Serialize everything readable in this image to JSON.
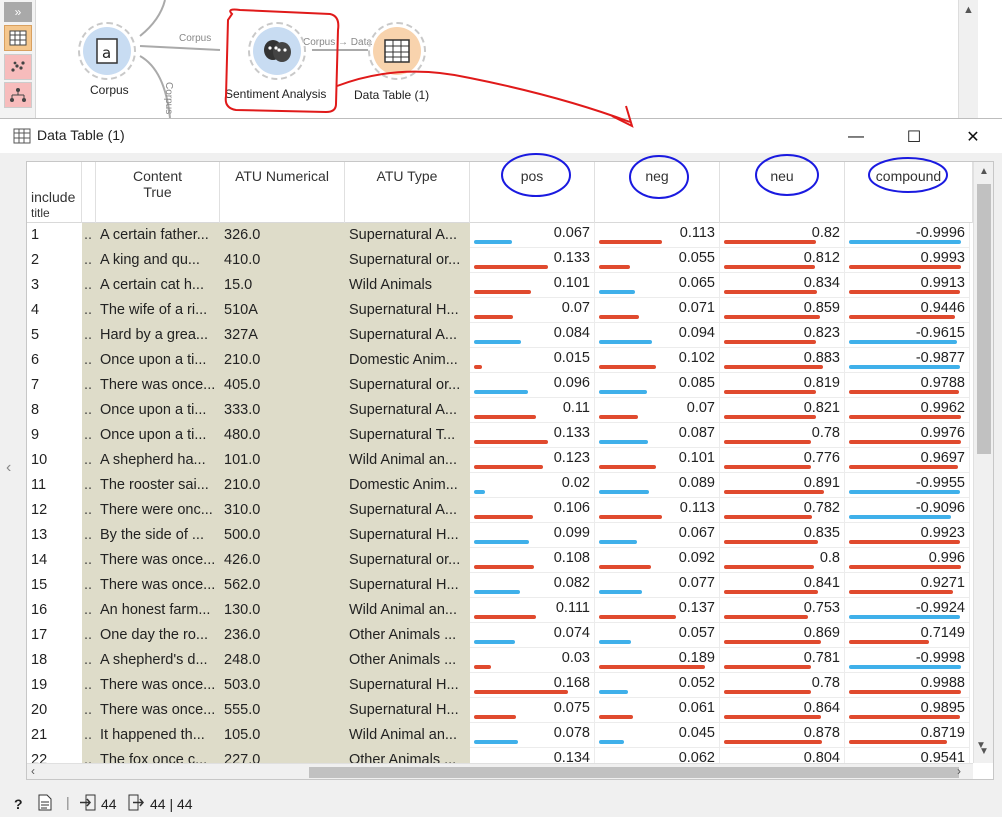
{
  "canvas": {
    "toolbox_expand": "»",
    "nodes": {
      "corpus": {
        "label": "Corpus",
        "glyph": "a"
      },
      "sentiment": {
        "label": "Sentiment Analysis"
      },
      "datatable": {
        "label": "Data Table (1)"
      }
    },
    "links": {
      "corpus_to_sentiment": "Corpus",
      "corpus_down": "Corpus",
      "sentiment_to_table": "Corpus → Data"
    }
  },
  "window": {
    "title": "Data Table (1)",
    "min_glyph": "—",
    "max_glyph": "☐",
    "close_glyph": "✕",
    "collapse_glyph": "‹"
  },
  "table": {
    "headers": {
      "include": "include",
      "include_sub": "title",
      "content": "Content",
      "content_sub": "True",
      "atu_num": "ATU Numerical",
      "atu_type": "ATU Type",
      "pos": "pos",
      "neg": "neg",
      "neu": "neu",
      "compound": "compound"
    },
    "rows": [
      {
        "i": "1",
        "c": "A certain father...",
        "n": "326.0",
        "t": "Supernatural A...",
        "pos": "0.067",
        "neg": "0.113",
        "neu": "0.82",
        "cmp": "-0.9996"
      },
      {
        "i": "2",
        "c": "A king and qu...",
        "n": "410.0",
        "t": "Supernatural or...",
        "pos": "0.133",
        "neg": "0.055",
        "neu": "0.812",
        "cmp": "0.9993"
      },
      {
        "i": "3",
        "c": "A certain cat h...",
        "n": "15.0",
        "t": "Wild Animals",
        "pos": "0.101",
        "neg": "0.065",
        "neu": "0.834",
        "cmp": "0.9913"
      },
      {
        "i": "4",
        "c": "The wife of a ri...",
        "n": "510A",
        "t": "Supernatural H...",
        "pos": "0.07",
        "neg": "0.071",
        "neu": "0.859",
        "cmp": "0.9446"
      },
      {
        "i": "5",
        "c": "Hard by a grea...",
        "n": "327A",
        "t": "Supernatural A...",
        "pos": "0.084",
        "neg": "0.094",
        "neu": "0.823",
        "cmp": "-0.9615"
      },
      {
        "i": "6",
        "c": "Once upon a ti...",
        "n": "210.0",
        "t": "Domestic Anim...",
        "pos": "0.015",
        "neg": "0.102",
        "neu": "0.883",
        "cmp": "-0.9877"
      },
      {
        "i": "7",
        "c": "There was once...",
        "n": "405.0",
        "t": "Supernatural or...",
        "pos": "0.096",
        "neg": "0.085",
        "neu": "0.819",
        "cmp": "0.9788"
      },
      {
        "i": "8",
        "c": "Once upon a ti...",
        "n": "333.0",
        "t": "Supernatural A...",
        "pos": "0.11",
        "neg": "0.07",
        "neu": "0.821",
        "cmp": "0.9962"
      },
      {
        "i": "9",
        "c": "Once upon a ti...",
        "n": "480.0",
        "t": "Supernatural T...",
        "pos": "0.133",
        "neg": "0.087",
        "neu": "0.78",
        "cmp": "0.9976"
      },
      {
        "i": "10",
        "c": "A shepherd ha...",
        "n": "101.0",
        "t": "Wild Animal an...",
        "pos": "0.123",
        "neg": "0.101",
        "neu": "0.776",
        "cmp": "0.9697"
      },
      {
        "i": "11",
        "c": "The rooster sai...",
        "n": "210.0",
        "t": "Domestic Anim...",
        "pos": "0.02",
        "neg": "0.089",
        "neu": "0.891",
        "cmp": "-0.9955"
      },
      {
        "i": "12",
        "c": "There were onc...",
        "n": "310.0",
        "t": "Supernatural A...",
        "pos": "0.106",
        "neg": "0.113",
        "neu": "0.782",
        "cmp": "-0.9096"
      },
      {
        "i": "13",
        "c": "By the side of ...",
        "n": "500.0",
        "t": "Supernatural H...",
        "pos": "0.099",
        "neg": "0.067",
        "neu": "0.835",
        "cmp": "0.9923"
      },
      {
        "i": "14",
        "c": "There was once...",
        "n": "426.0",
        "t": "Supernatural or...",
        "pos": "0.108",
        "neg": "0.092",
        "neu": "0.8",
        "cmp": "0.996"
      },
      {
        "i": "15",
        "c": "There was once...",
        "n": "562.0",
        "t": "Supernatural H...",
        "pos": "0.082",
        "neg": "0.077",
        "neu": "0.841",
        "cmp": "0.9271"
      },
      {
        "i": "16",
        "c": "An honest farm...",
        "n": "130.0",
        "t": "Wild Animal an...",
        "pos": "0.111",
        "neg": "0.137",
        "neu": "0.753",
        "cmp": "-0.9924"
      },
      {
        "i": "17",
        "c": "One day the ro...",
        "n": "236.0",
        "t": "Other Animals ...",
        "pos": "0.074",
        "neg": "0.057",
        "neu": "0.869",
        "cmp": "0.7149"
      },
      {
        "i": "18",
        "c": "A shepherd's d...",
        "n": "248.0",
        "t": "Other Animals ...",
        "pos": "0.03",
        "neg": "0.189",
        "neu": "0.781",
        "cmp": "-0.9998"
      },
      {
        "i": "19",
        "c": "There was once...",
        "n": "503.0",
        "t": "Supernatural H...",
        "pos": "0.168",
        "neg": "0.052",
        "neu": "0.78",
        "cmp": "0.9988"
      },
      {
        "i": "20",
        "c": "There was once...",
        "n": "555.0",
        "t": "Supernatural H...",
        "pos": "0.075",
        "neg": "0.061",
        "neu": "0.864",
        "cmp": "0.9895"
      },
      {
        "i": "21",
        "c": "It happened th...",
        "n": "105.0",
        "t": "Wild Animal an...",
        "pos": "0.078",
        "neg": "0.045",
        "neu": "0.878",
        "cmp": "0.8719"
      },
      {
        "i": "22",
        "c": "The fox once c...",
        "n": "227.0",
        "t": "Other Animals ...",
        "pos": "0.134",
        "neg": "0.062",
        "neu": "0.804",
        "cmp": "0.9541"
      }
    ],
    "dots": "..",
    "bar_colors": {
      "red": "#e04a2e",
      "blue": "#3fb0ea"
    }
  },
  "statusbar": {
    "help_icon": "?",
    "input_count": "44",
    "output_count": "44 | 44"
  }
}
